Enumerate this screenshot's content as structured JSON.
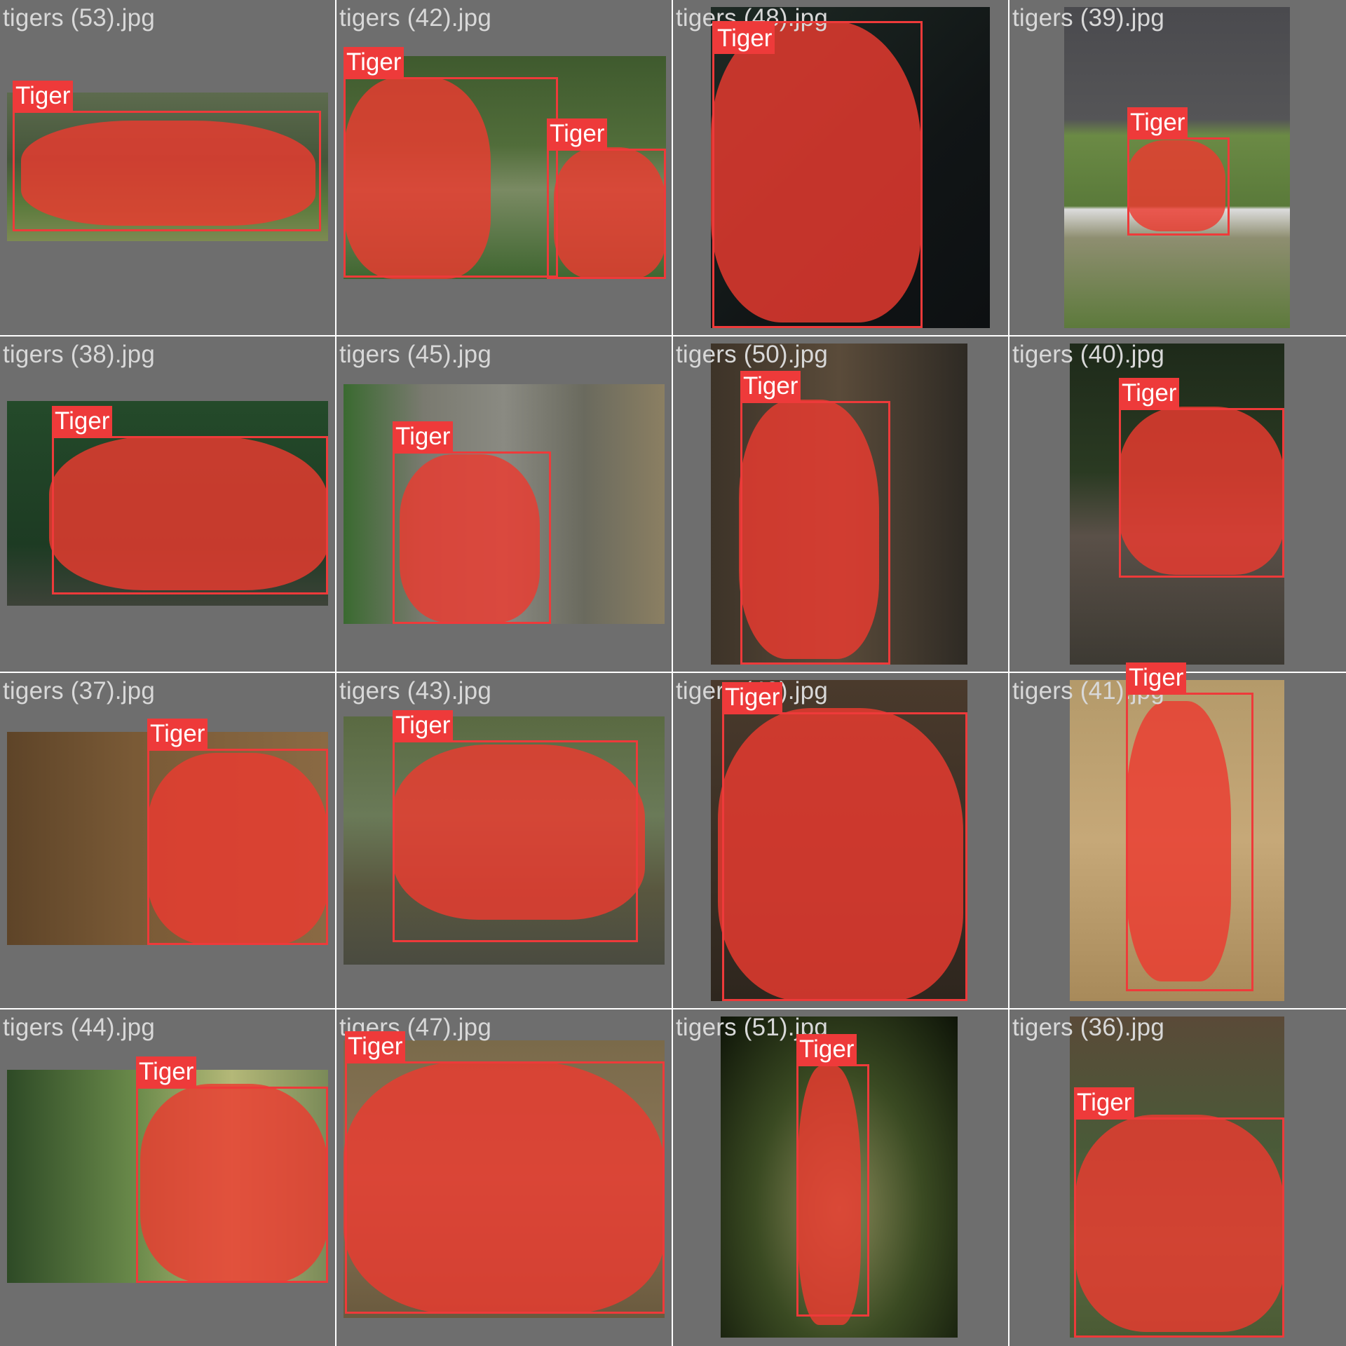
{
  "grid": {
    "tiles": [
      {
        "filename": "tigers (53).jpg",
        "label": "Tiger"
      },
      {
        "filename": "tigers (42).jpg",
        "labels": [
          "Tiger",
          "Tiger"
        ]
      },
      {
        "filename": "tigers (48).jpg",
        "label": "Tiger"
      },
      {
        "filename": "tigers (39).jpg",
        "label": "Tiger"
      },
      {
        "filename": "tigers (38).jpg",
        "label": "Tiger"
      },
      {
        "filename": "tigers (45).jpg",
        "label": "Tiger"
      },
      {
        "filename": "tigers (50).jpg",
        "label": "Tiger"
      },
      {
        "filename": "tigers (40).jpg",
        "label": "Tiger"
      },
      {
        "filename": "tigers (37).jpg",
        "label": "Tiger"
      },
      {
        "filename": "tigers (43).jpg",
        "label": "Tiger"
      },
      {
        "filename": "tigers (49).jpg",
        "label": "Tiger"
      },
      {
        "filename": "tigers (41).jpg",
        "label": "Tiger"
      },
      {
        "filename": "tigers (44).jpg",
        "label": "Tiger"
      },
      {
        "filename": "tigers (47).jpg",
        "label": "Tiger"
      },
      {
        "filename": "tigers (51).jpg",
        "label": "Tiger"
      },
      {
        "filename": "tigers (36).jpg",
        "label": "Tiger"
      }
    ]
  },
  "colors": {
    "background": "#6e6e6e",
    "bbox": "#ee3a3a",
    "mask": "#ec3a30",
    "filename_text": "#d8d8d8"
  }
}
